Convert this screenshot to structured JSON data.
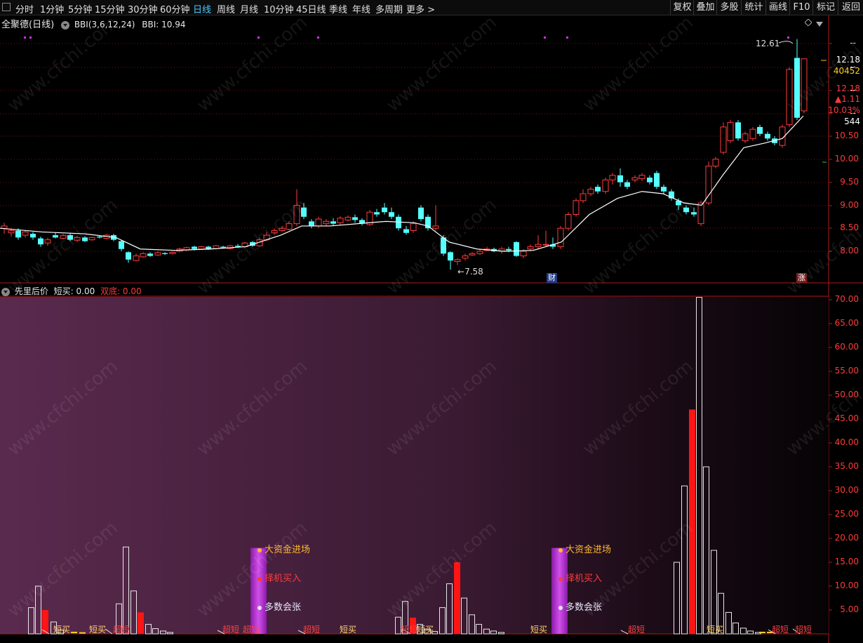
{
  "toolbar": {
    "items": [
      {
        "label": "分时"
      },
      {
        "label": "1分钟"
      },
      {
        "label": "5分钟"
      },
      {
        "label": "15分钟"
      },
      {
        "label": "30分钟"
      },
      {
        "label": "60分钟"
      },
      {
        "label": "日线"
      },
      {
        "label": "周线"
      },
      {
        "label": "月线"
      },
      {
        "label": "10分钟"
      },
      {
        "label": "45日线"
      },
      {
        "label": "季线"
      },
      {
        "label": "年线"
      },
      {
        "label": "多周期"
      },
      {
        "label": "更多 >"
      }
    ],
    "active_index": 6,
    "right_buttons": [
      {
        "label": "复权"
      },
      {
        "label": "叠加"
      },
      {
        "label": "多股"
      },
      {
        "label": "统计"
      },
      {
        "label": "画线"
      },
      {
        "label": "F10"
      },
      {
        "label": "标记"
      },
      {
        "label": "返回"
      }
    ]
  },
  "main_panel": {
    "stock_title": "全聚德(日线)",
    "indicator_name": "BBI(3,6,12,24)",
    "indicator_value": "BBI: 10.94",
    "high_label": "12.61",
    "low_label": "7.58",
    "badge_cai": "财",
    "badge_zhang": "涨",
    "axis_ticks": [
      "10.50",
      "10.00",
      "9.50",
      "9.00",
      "8.50",
      "8.00"
    ],
    "axis_dashes": [
      "--",
      "--",
      "--",
      "--",
      "--",
      "--"
    ],
    "info_box": {
      "last_price": "12.18",
      "volume": "40452",
      "price": "12.18",
      "change": "▲1.11",
      "change_pct": "10.03%",
      "count": "544"
    }
  },
  "sub_panel": {
    "title": "先里后价",
    "short_buy": "短买: 0.00",
    "double_bottom": "双底: 0.00",
    "axis_ticks": [
      "70.00",
      "65.00",
      "60.00",
      "55.00",
      "50.00",
      "45.00",
      "40.00",
      "35.00",
      "30.00",
      "25.00",
      "20.00",
      "15.00",
      "10.00",
      "5.00"
    ],
    "legend_a": [
      "大资金进场",
      "择机买入",
      "多数会张"
    ],
    "legend_b": [
      "大资金进场",
      "择机买入",
      "多数会张"
    ],
    "signals": [
      {
        "text": "短买",
        "color": "#ffd36b"
      },
      {
        "text": "短买",
        "color": "#ffd36b"
      },
      {
        "text": "超短",
        "color": "#ff4040"
      },
      {
        "text": "超短",
        "color": "#ff4040"
      },
      {
        "text": "超短",
        "color": "#ff4040"
      },
      {
        "text": "超短",
        "color": "#ff4040"
      },
      {
        "text": "短买",
        "color": "#ffd36b"
      },
      {
        "text": "超短",
        "color": "#ff4040"
      },
      {
        "text": "短买",
        "color": "#ffd36b"
      },
      {
        "text": "短买",
        "color": "#ffd36b"
      },
      {
        "text": "超短",
        "color": "#ff4040"
      },
      {
        "text": "短买",
        "color": "#ffd36b"
      },
      {
        "text": "超短",
        "color": "#ff4040"
      },
      {
        "text": "超短",
        "color": "#ff4040"
      }
    ]
  },
  "watermark": "www.cfchi.com",
  "colors": {
    "up": "#ff3b3b",
    "down": "#54ffff",
    "bbi": "#ffffff",
    "grid": "#7a1010",
    "border": "#b01818",
    "purple": "#b030c8",
    "legend_gold": "#ffb830",
    "legend_red": "#ff3b3b",
    "legend_white": "#e8e8ff"
  }
}
